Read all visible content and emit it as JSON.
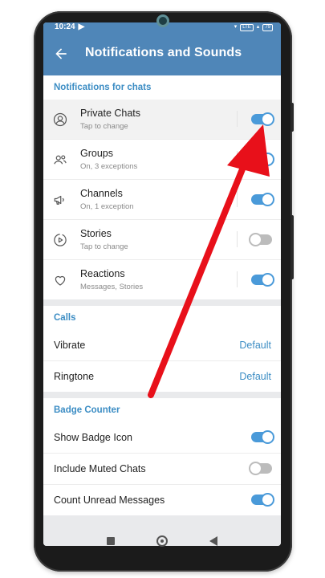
{
  "status_bar": {
    "time": "10:24",
    "battery": "79"
  },
  "app_bar": {
    "title": "Notifications and Sounds"
  },
  "notifications": {
    "header": "Notifications for chats",
    "items": [
      {
        "label": "Private Chats",
        "sub": "Tap to change",
        "icon": "person-icon",
        "on": true
      },
      {
        "label": "Groups",
        "sub": "On, 3 exceptions",
        "icon": "group-icon",
        "on": true
      },
      {
        "label": "Channels",
        "sub": "On, 1 exception",
        "icon": "megaphone-icon",
        "on": true
      },
      {
        "label": "Stories",
        "sub": "Tap to change",
        "icon": "stories-icon",
        "on": false
      },
      {
        "label": "Reactions",
        "sub": "Messages, Stories",
        "icon": "heart-icon",
        "on": true
      }
    ]
  },
  "calls": {
    "header": "Calls",
    "vibrate": {
      "label": "Vibrate",
      "value": "Default"
    },
    "ringtone": {
      "label": "Ringtone",
      "value": "Default"
    }
  },
  "badge": {
    "header": "Badge Counter",
    "items": [
      {
        "label": "Show Badge Icon",
        "on": true
      },
      {
        "label": "Include Muted Chats",
        "on": false
      },
      {
        "label": "Count Unread Messages",
        "on": true
      }
    ]
  },
  "colors": {
    "accent": "#4f86b8",
    "toggle_on": "#4a9ad9",
    "section_text": "#3c8dc4",
    "arrow": "#e8101a"
  }
}
